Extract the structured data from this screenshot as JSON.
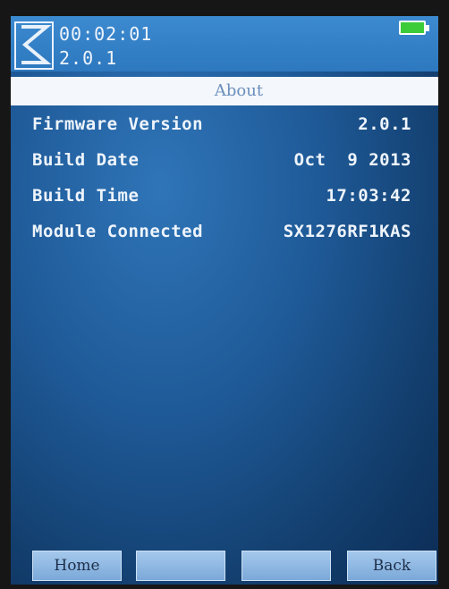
{
  "status": {
    "time": "00:02:01",
    "firmware": "2.0.1",
    "battery_color": "#3ccc3a"
  },
  "header": {
    "title": "About"
  },
  "info": [
    {
      "label": "Firmware Version",
      "value": "2.0.1"
    },
    {
      "label": "Build Date",
      "value": "Oct  9 2013"
    },
    {
      "label": "Build Time",
      "value": "17:03:42"
    },
    {
      "label": "Module Connected",
      "value": "SX1276RF1KAS"
    }
  ],
  "softkeys": [
    "Home",
    "",
    "",
    "Back"
  ],
  "colors": {
    "screen": "#1f5a98",
    "softkey": "#8fb8e3"
  }
}
